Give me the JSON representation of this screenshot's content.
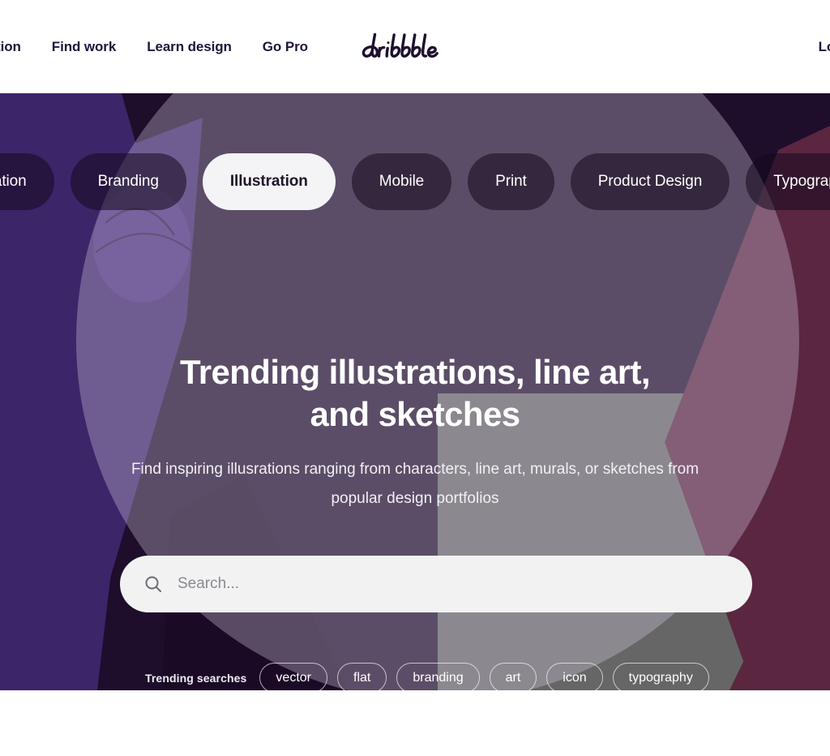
{
  "header": {
    "nav_left": [
      {
        "label": "Inspiration",
        "name": "nav-inspiration"
      },
      {
        "label": "Find work",
        "name": "nav-find-work"
      },
      {
        "label": "Learn design",
        "name": "nav-learn-design"
      },
      {
        "label": "Go Pro",
        "name": "nav-go-pro"
      }
    ],
    "logo_text": "dribbble",
    "nav_right": [
      {
        "label": "Log in",
        "name": "nav-log-in"
      }
    ]
  },
  "hero": {
    "categories": [
      {
        "label": "Animation",
        "active": false
      },
      {
        "label": "Branding",
        "active": false
      },
      {
        "label": "Illustration",
        "active": true
      },
      {
        "label": "Mobile",
        "active": false
      },
      {
        "label": "Print",
        "active": false
      },
      {
        "label": "Product Design",
        "active": false
      },
      {
        "label": "Typography",
        "active": false
      }
    ],
    "headline_line1": "Trending illustrations, line art,",
    "headline_line2": "and sketches",
    "subhead_line1": "Find inspiring illusrations ranging from characters, line art, murals, or sketches from",
    "subhead_line2": "popular design portfolios",
    "search": {
      "placeholder": "Search...",
      "value": "",
      "icon": "search-icon"
    },
    "trending": {
      "label": "Trending searches",
      "tags": [
        "vector",
        "flat",
        "branding",
        "art",
        "icon",
        "typography"
      ]
    }
  },
  "colors": {
    "bg_dark_purple": "#1e0d2b",
    "bg_purple": "#3c2569",
    "bg_maroon": "#5a2640",
    "bg_grey": "#666666",
    "overlay_circle": "#544d63",
    "active_pill": "#f4f3f6",
    "search_bg": "#f2f2f3",
    "text_dark": "#20143b",
    "page_bg": "#ffffff"
  }
}
